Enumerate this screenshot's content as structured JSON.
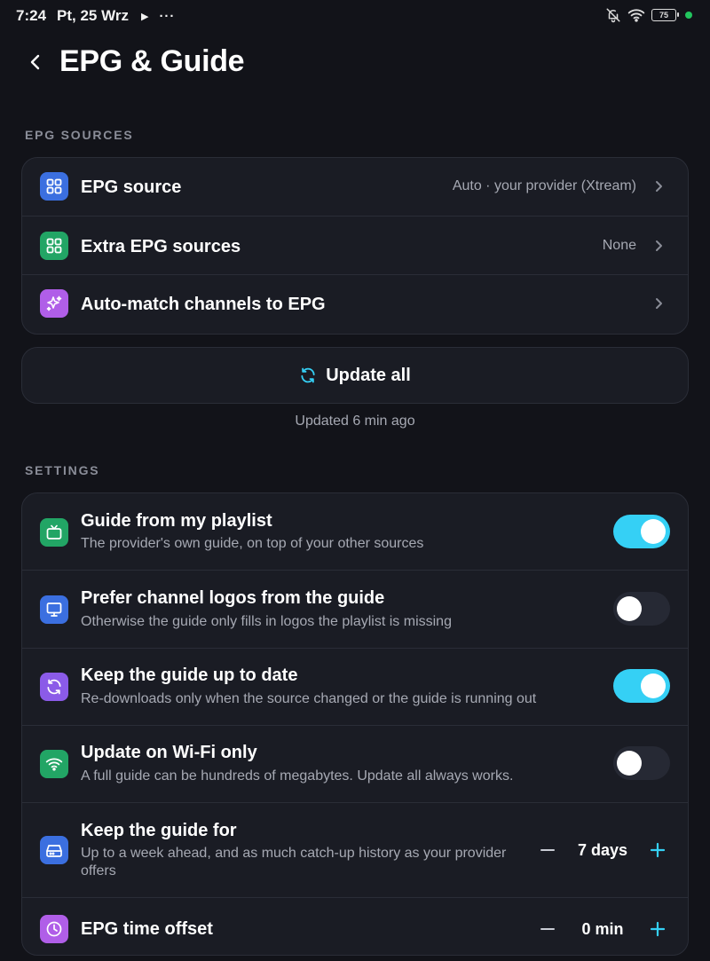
{
  "status_bar": {
    "time": "7:24",
    "date": "Pt, 25 Wrz",
    "battery": "75",
    "play_glyph": "▶",
    "more_glyph": "···"
  },
  "header": {
    "title": "EPG & Guide"
  },
  "sources": {
    "label": "EPG SOURCES",
    "items": [
      {
        "title": "EPG source",
        "value": "Auto · your provider (Xtream)",
        "icon": "grid-icon",
        "color": "#3b6fe0"
      },
      {
        "title": "Extra EPG sources",
        "value": "None",
        "icon": "grid-icon",
        "color": "#22a565"
      },
      {
        "title": "Auto-match channels to EPG",
        "value": "",
        "icon": "sparkle-icon",
        "color": "#b05ee8"
      }
    ]
  },
  "update": {
    "button_label": "Update all",
    "status": "Updated 6 min ago"
  },
  "settings": {
    "label": "SETTINGS",
    "items": [
      {
        "title": "Guide from my playlist",
        "subtitle": "The provider's own guide, on top of your other sources",
        "enabled": true,
        "icon": "tv-icon",
        "color": "#22a565"
      },
      {
        "title": "Prefer channel logos from the guide",
        "subtitle": "Otherwise the guide only fills in logos the playlist is missing",
        "enabled": false,
        "icon": "monitor-icon",
        "color": "#3b6fe0"
      },
      {
        "title": "Keep the guide up to date",
        "subtitle": "Re-downloads only when the source changed or the guide is running out",
        "enabled": true,
        "icon": "refresh-icon",
        "color": "#8b5be8"
      },
      {
        "title": "Update on Wi-Fi only",
        "subtitle": "A full guide can be hundreds of megabytes. Update all always works.",
        "enabled": false,
        "icon": "wifi-icon",
        "color": "#22a565"
      },
      {
        "title": "Keep the guide for",
        "subtitle_line1": "Up to a week ahead, and as much catch-up history as your provider",
        "subtitle_line2": "offers",
        "value": "7 days",
        "icon": "storage-icon",
        "color": "#3b6fe0"
      },
      {
        "title": "EPG time offset",
        "value": "0 min",
        "icon": "clock-icon",
        "color": "#b05ee8"
      }
    ]
  },
  "colors": {
    "background": "#121319",
    "card": "#1a1c24",
    "accent": "#35d0f5",
    "muted": "#a6a9b3"
  }
}
